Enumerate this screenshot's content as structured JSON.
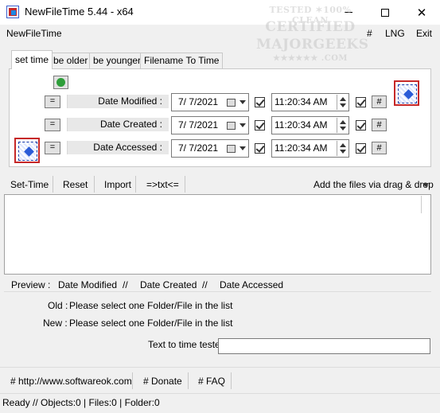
{
  "window": {
    "title": "NewFileTime 5.44 - x64"
  },
  "watermark": {
    "line1": "TESTED ✶100% CLEAN",
    "line2": "CERTIFIED",
    "line3": "MAJORGEEKS",
    "line4": "★★★★★★ .COM"
  },
  "menu": {
    "app": "NewFileTime",
    "hash": "#",
    "lng": "LNG",
    "exit": "Exit"
  },
  "tabs": [
    "set time",
    "be older",
    "be younger",
    "Filename To Time"
  ],
  "rows": [
    {
      "eq": "=",
      "label": "Date Modified :",
      "date": "7/  7/2021",
      "time": "11:20:34 AM",
      "hash": "#"
    },
    {
      "eq": "=",
      "label": "Date Created :",
      "date": "7/  7/2021",
      "time": "11:20:34 AM",
      "hash": "#"
    },
    {
      "eq": "=",
      "label": "Date Accessed :",
      "date": "7/  7/2021",
      "time": "11:20:34 AM",
      "hash": "#"
    }
  ],
  "toolbar": {
    "set_time": "Set-Time",
    "reset": "Reset",
    "import": "Import",
    "txt": "=>txt<=",
    "drag_drop": "Add the files via drag & drop"
  },
  "preview": {
    "label": "Preview  :",
    "modified": "Date Modified",
    "sep": "//",
    "created": "Date Created",
    "accessed": "Date Accessed",
    "old_label": "Old :",
    "old_value": "Please select one Folder/File in the list",
    "new_label": "New :",
    "new_value": "Please select one Folder/File in the list",
    "tester_label": "Text to time tester",
    "tester_value": ""
  },
  "links": {
    "website": "# http://www.softwareok.com",
    "donate": "# Donate",
    "faq": "# FAQ"
  },
  "status": {
    "text": "Ready // Objects:0  | Files:0   | Folder:0"
  },
  "icons": {
    "app": "newfiletime-app-icon",
    "refresh": "refresh-icon",
    "big": "drag-drop-target-icon"
  }
}
